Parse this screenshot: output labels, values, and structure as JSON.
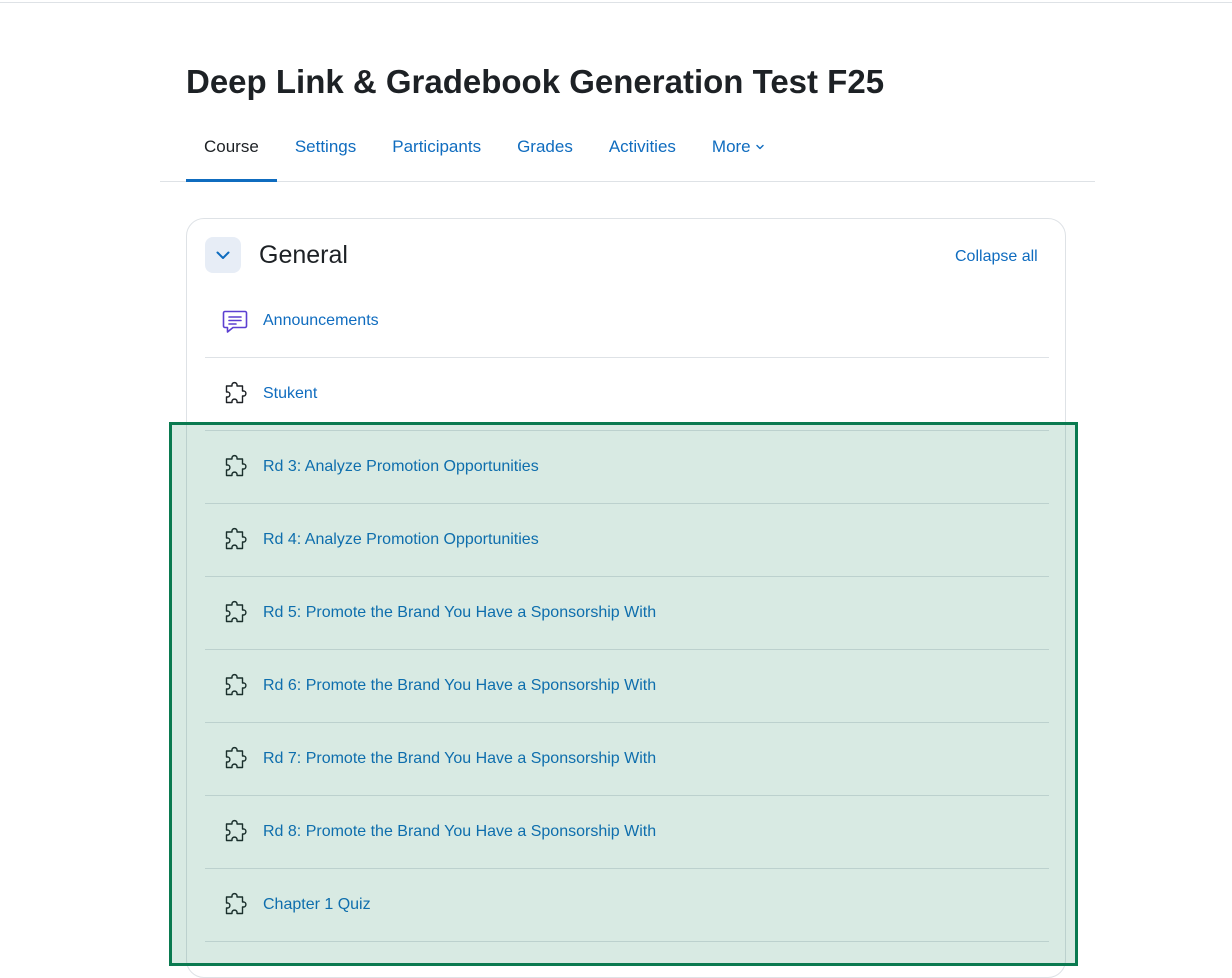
{
  "page": {
    "title": "Deep Link & Gradebook Generation Test F25"
  },
  "nav": {
    "tabs": [
      {
        "label": "Course",
        "active": true
      },
      {
        "label": "Settings",
        "active": false
      },
      {
        "label": "Participants",
        "active": false
      },
      {
        "label": "Grades",
        "active": false
      },
      {
        "label": "Activities",
        "active": false
      },
      {
        "label": "More",
        "active": false,
        "has_dropdown": true
      }
    ]
  },
  "section": {
    "title": "General",
    "collapse_all_label": "Collapse all",
    "toggle_icon": "chevron-down-icon"
  },
  "activities": [
    {
      "label": "Announcements",
      "icon": "forum-icon"
    },
    {
      "label": "Stukent",
      "icon": "puzzle-icon"
    },
    {
      "label": "Rd 3: Analyze Promotion Opportunities",
      "icon": "puzzle-icon"
    },
    {
      "label": "Rd 4: Analyze Promotion Opportunities",
      "icon": "puzzle-icon"
    },
    {
      "label": "Rd 5: Promote the Brand You Have a Sponsorship With",
      "icon": "puzzle-icon"
    },
    {
      "label": "Rd 6: Promote the Brand You Have a Sponsorship With",
      "icon": "puzzle-icon"
    },
    {
      "label": "Rd 7: Promote the Brand You Have a Sponsorship With",
      "icon": "puzzle-icon"
    },
    {
      "label": "Rd 8: Promote the Brand You Have a Sponsorship With",
      "icon": "puzzle-icon"
    },
    {
      "label": "Chapter 1 Quiz",
      "icon": "puzzle-icon"
    }
  ],
  "colors": {
    "link": "#0f6cbf",
    "text": "#1d2125",
    "forum_icon": "#5b3fd1",
    "highlight_border": "#0a7a50",
    "highlight_fill": "#d7e9e1"
  }
}
